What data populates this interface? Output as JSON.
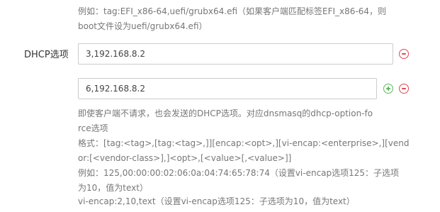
{
  "top_hint": {
    "line1": "例如：tag:EFI_x86-64,uefi/grubx64.efi（如果客户端匹配标签EFI_x86-64，则",
    "line2": "boot文件设为uefi/grubx64.efi）"
  },
  "dhcp_option": {
    "label": "DHCP选项",
    "values": [
      "3,192.168.8.2",
      "6,192.168.8.2"
    ]
  },
  "icons": {
    "remove": "minus-circle-icon",
    "add": "plus-circle-icon",
    "remove_color": "#e0484f",
    "add_color": "#5cb85c"
  },
  "help": {
    "lines": [
      "即使客户端不请求，也会发送的DHCP选项。对应dnsmasq的dhcp-option-fo",
      "rce选项",
      "格式：[tag:<tag>,[tag:<tag>,]][encap:<opt>,][vi-encap:<enterprise>,][vend",
      "or:[<vendor-class>],]<opt>,[<value>[,<value>]]",
      "例如：125,00:00:00:02:06:0a:04:74:65:78:74（设置vi-encap选项125：子选项",
      "为10，值为text）",
      "vi-encap:2,10,text（设置vi-encap选项125：子选项为10，值为text）"
    ]
  }
}
